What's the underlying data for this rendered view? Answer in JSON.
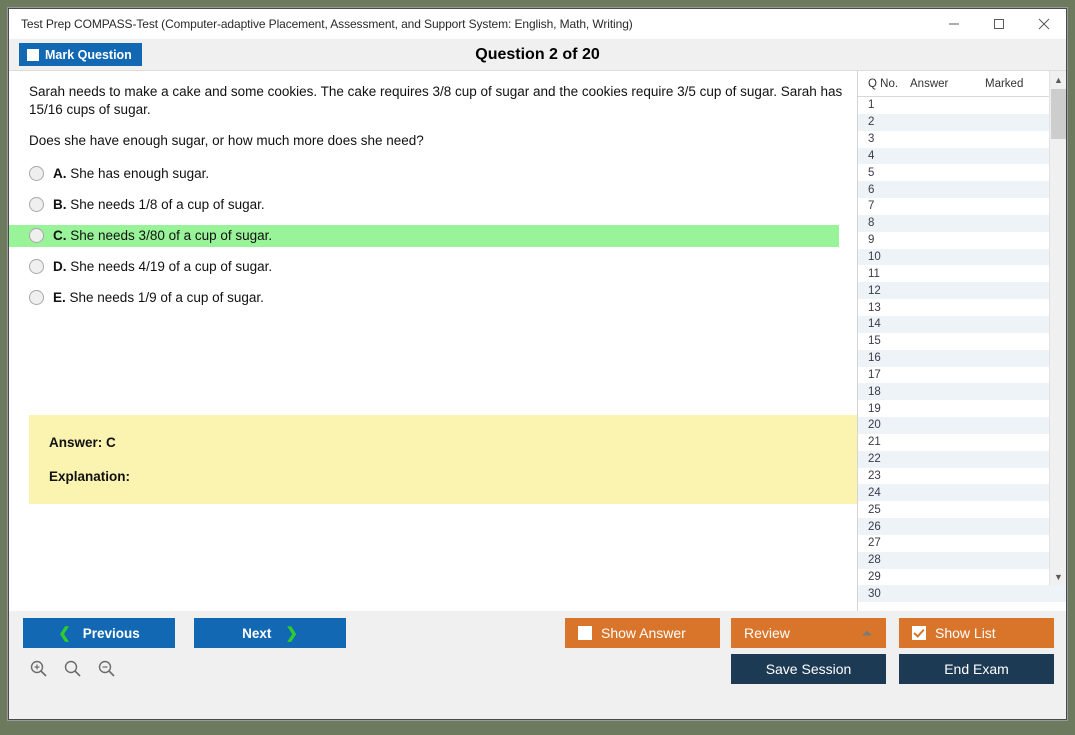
{
  "window": {
    "title": "Test Prep COMPASS-Test (Computer-adaptive Placement, Assessment, and Support System: English, Math, Writing)",
    "minimize_label": "minimize-icon",
    "maximize_label": "maximize-icon",
    "close_label": "close-icon"
  },
  "header": {
    "mark_question_label": "Mark Question",
    "mark_question_checked": false,
    "question_title": "Question 2 of 20"
  },
  "question": {
    "paragraphs": [
      "Sarah needs to make a cake and some cookies. The cake requires 3/8 cup of sugar and the cookies require 3/5 cup of sugar. Sarah has 15/16 cups of sugar.",
      "Does she have enough sugar, or how much more does she need?"
    ],
    "options": [
      {
        "letter": "A.",
        "text": "She has enough sugar.",
        "highlighted": false
      },
      {
        "letter": "B.",
        "text": "She needs 1/8 of a cup of sugar.",
        "highlighted": false
      },
      {
        "letter": "C.",
        "text": "She needs 3/80 of a cup of sugar.",
        "highlighted": true
      },
      {
        "letter": "D.",
        "text": "She needs 4/19 of a cup of sugar.",
        "highlighted": false
      },
      {
        "letter": "E.",
        "text": "She needs 1/9 of a cup of sugar.",
        "highlighted": false
      }
    ],
    "answer_label": "Answer: C",
    "explanation_label": "Explanation:"
  },
  "list_panel": {
    "columns": [
      "Q No.",
      "Answer",
      "Marked"
    ],
    "rows": [
      {
        "no": "1",
        "answer": "",
        "marked": ""
      },
      {
        "no": "2",
        "answer": "",
        "marked": ""
      },
      {
        "no": "3",
        "answer": "",
        "marked": ""
      },
      {
        "no": "4",
        "answer": "",
        "marked": ""
      },
      {
        "no": "5",
        "answer": "",
        "marked": ""
      },
      {
        "no": "6",
        "answer": "",
        "marked": ""
      },
      {
        "no": "7",
        "answer": "",
        "marked": ""
      },
      {
        "no": "8",
        "answer": "",
        "marked": ""
      },
      {
        "no": "9",
        "answer": "",
        "marked": ""
      },
      {
        "no": "10",
        "answer": "",
        "marked": ""
      },
      {
        "no": "11",
        "answer": "",
        "marked": ""
      },
      {
        "no": "12",
        "answer": "",
        "marked": ""
      },
      {
        "no": "13",
        "answer": "",
        "marked": ""
      },
      {
        "no": "14",
        "answer": "",
        "marked": ""
      },
      {
        "no": "15",
        "answer": "",
        "marked": ""
      },
      {
        "no": "16",
        "answer": "",
        "marked": ""
      },
      {
        "no": "17",
        "answer": "",
        "marked": ""
      },
      {
        "no": "18",
        "answer": "",
        "marked": ""
      },
      {
        "no": "19",
        "answer": "",
        "marked": ""
      },
      {
        "no": "20",
        "answer": "",
        "marked": ""
      },
      {
        "no": "21",
        "answer": "",
        "marked": ""
      },
      {
        "no": "22",
        "answer": "",
        "marked": ""
      },
      {
        "no": "23",
        "answer": "",
        "marked": ""
      },
      {
        "no": "24",
        "answer": "",
        "marked": ""
      },
      {
        "no": "25",
        "answer": "",
        "marked": ""
      },
      {
        "no": "26",
        "answer": "",
        "marked": ""
      },
      {
        "no": "27",
        "answer": "",
        "marked": ""
      },
      {
        "no": "28",
        "answer": "",
        "marked": ""
      },
      {
        "no": "29",
        "answer": "",
        "marked": ""
      },
      {
        "no": "30",
        "answer": "",
        "marked": ""
      }
    ],
    "scroll_up_icon": "chevron-up-icon",
    "scroll_down_icon": "chevron-down-icon"
  },
  "footer": {
    "previous_label": "Previous",
    "next_label": "Next",
    "show_answer_label": "Show Answer",
    "show_answer_checked": false,
    "review_label": "Review",
    "show_list_label": "Show List",
    "show_list_checked": true,
    "save_session_label": "Save Session",
    "end_exam_label": "End Exam",
    "zoom_in_icon": "zoom-in-icon",
    "zoom_reset_icon": "zoom-reset-icon",
    "zoom_out_icon": "zoom-out-icon"
  },
  "colors": {
    "primary_blue": "#1268b3",
    "orange": "#d9752b",
    "navy": "#1d3a54",
    "highlight_green": "#99f499",
    "answer_yellow": "#faf4b0"
  }
}
